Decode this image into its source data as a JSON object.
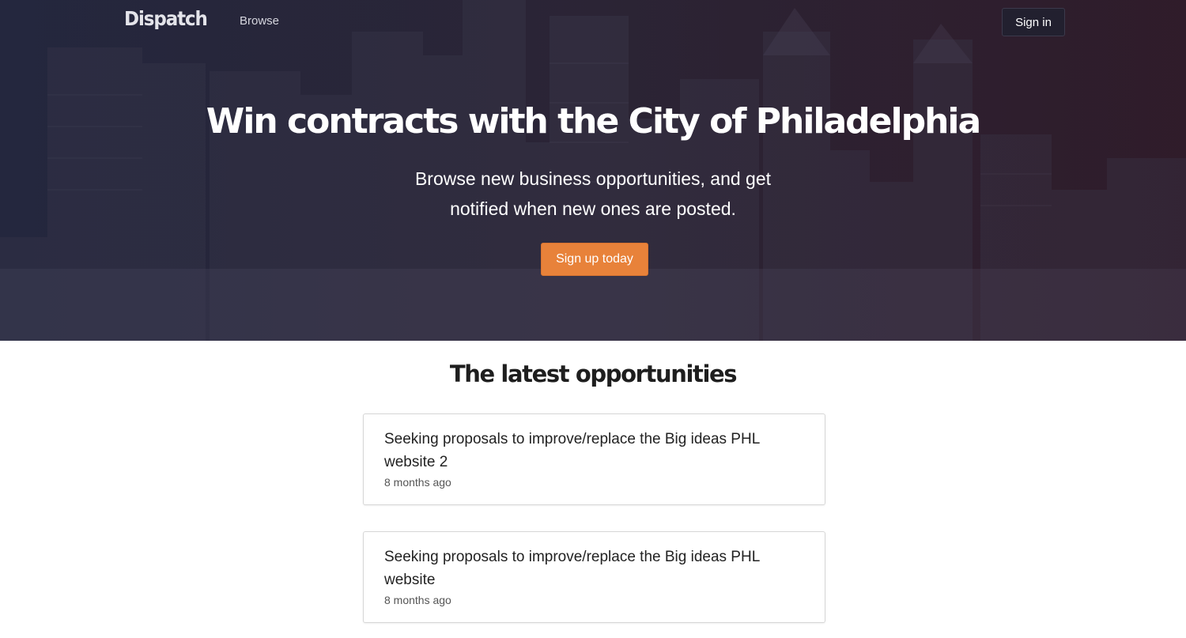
{
  "nav": {
    "brand": "Dispatch",
    "browse_label": "Browse",
    "signin_label": "Sign in"
  },
  "hero": {
    "title": "Win contracts with the City of Philadelphia",
    "subtitle": "Browse new business opportunities, and get notified when new ones are posted.",
    "cta_label": "Sign up today",
    "background_image": "philadelphia-skyline"
  },
  "latest": {
    "heading": "The latest opportunities",
    "items": [
      {
        "title": "Seeking proposals to improve/replace the Big ideas PHL website 2",
        "time": "8 months ago"
      },
      {
        "title": "Seeking proposals to improve/replace the Big ideas PHL website",
        "time": "8 months ago"
      }
    ]
  },
  "colors": {
    "cta": "#e8823a",
    "hero_dark": "#272a40",
    "hero_wine": "#2f1f2c"
  }
}
